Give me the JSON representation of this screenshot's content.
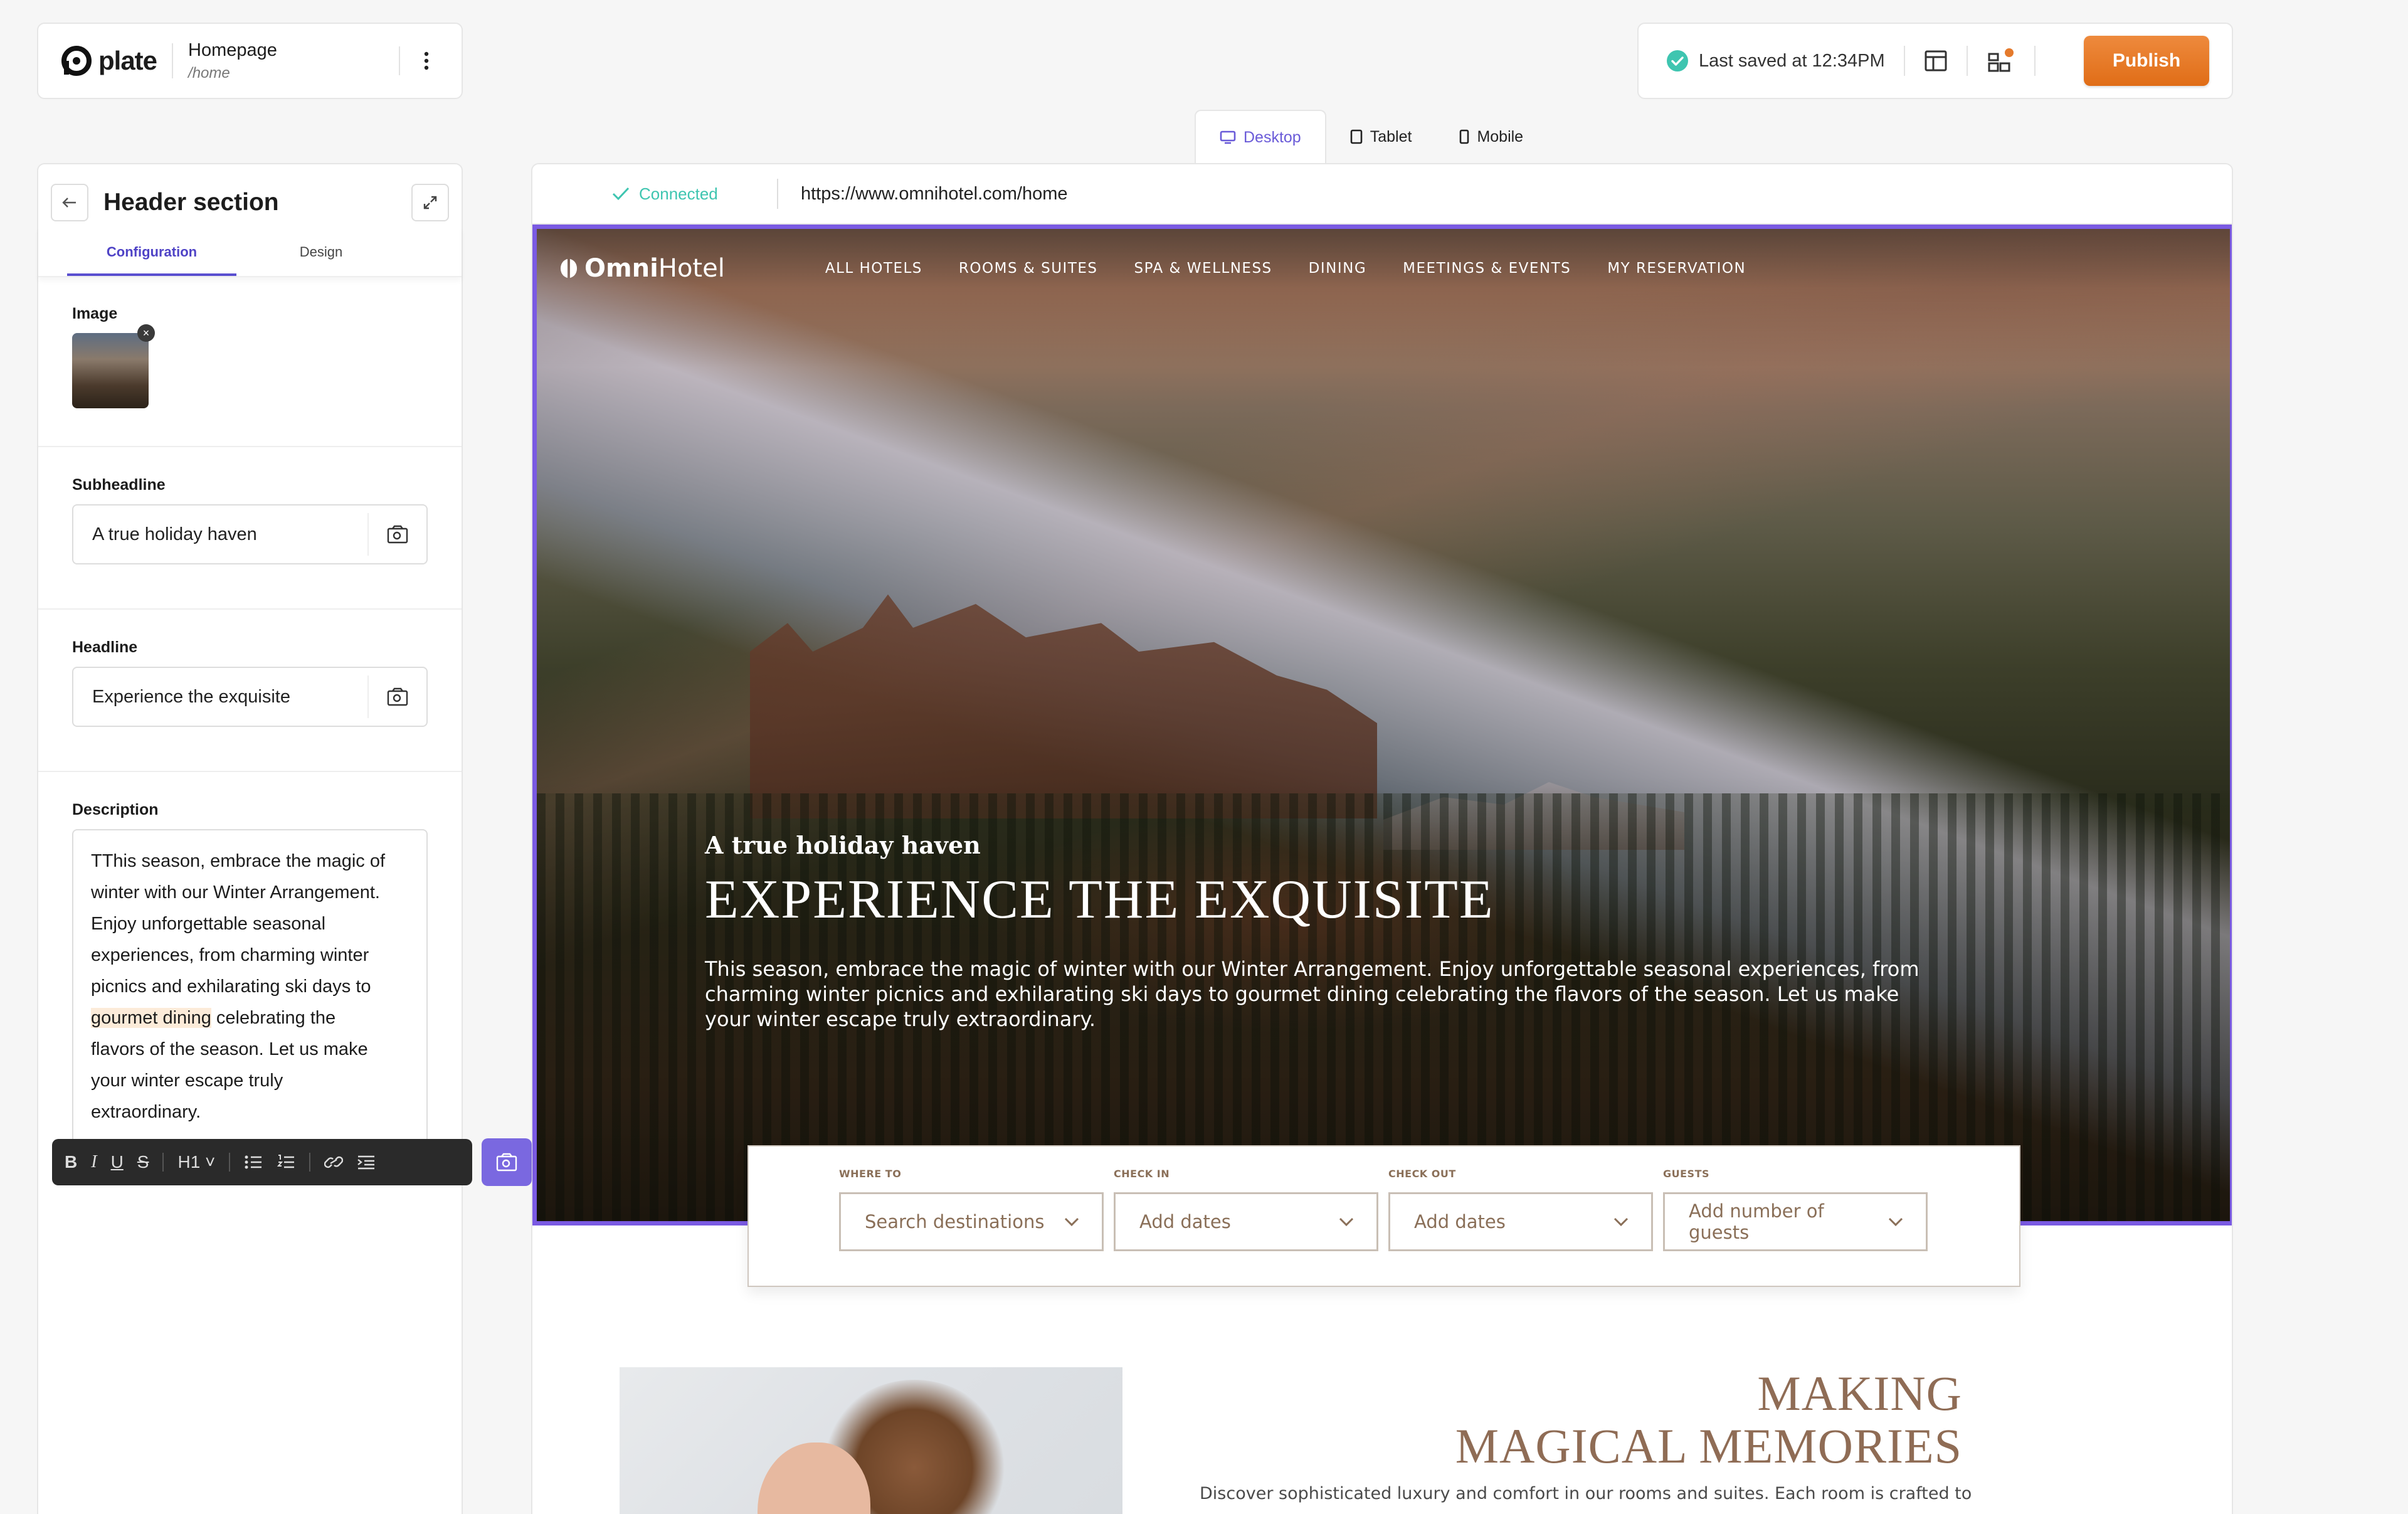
{
  "app": {
    "logo_text": "plate",
    "page_name": "Homepage",
    "page_path": "/home"
  },
  "status": {
    "saved_text": "Last saved at 12:34PM",
    "publish_label": "Publish",
    "accent": "#e57a2c"
  },
  "device_tabs": [
    {
      "label": "Desktop",
      "active": true
    },
    {
      "label": "Tablet",
      "active": false
    },
    {
      "label": "Mobile",
      "active": false
    }
  ],
  "panel": {
    "title": "Header section",
    "tabs": [
      "Configuration",
      "Design"
    ],
    "image_label": "Image",
    "subheadline_label": "Subheadline",
    "subheadline_value": "A true holiday haven",
    "headline_label": "Headline",
    "headline_value": "Experience the exquisite",
    "description_label": "Description",
    "description": {
      "line1": "TThis season, embrace the magic of",
      "line2": "winter with our Winter Arrangement.",
      "line3": "Enjoy unforgettable seasonal",
      "line4": "experiences, from charming winter",
      "line5": "picnics and exhilarating ski days to",
      "highlight": "gourmet dining",
      "line6_rest": " celebrating the",
      "line7": "flavors of the season. Let us make",
      "line8": "your winter escape truly",
      "line9": "extraordinary."
    }
  },
  "toolbar": {
    "heading_label": "H1"
  },
  "browser": {
    "connection": "Connected",
    "url": "https://www.omnihotel.com/home"
  },
  "site": {
    "brand_bold": "Omni",
    "brand_rest": "Hotel",
    "nav": [
      "ALL HOTELS",
      "ROOMS & SUITES",
      "SPA & WELLNESS",
      "DINING",
      "MEETINGS & EVENTS",
      "MY RESERVATION"
    ],
    "hero_sub": "A true holiday haven",
    "hero_head": "EXPERIENCE THE EXQUISITE",
    "hero_desc": "This season, embrace the magic of winter with our Winter Arrangement. Enjoy unforgettable seasonal experiences, from charming winter picnics and exhilarating ski days to gourmet dining celebrating the flavors of the season. Let us make your winter escape truly extraordinary.",
    "booking": [
      {
        "label": "WHERE TO",
        "placeholder": "Search destinations"
      },
      {
        "label": "CHECK IN",
        "placeholder": "Add dates"
      },
      {
        "label": "CHECK OUT",
        "placeholder": "Add dates"
      },
      {
        "label": "GUESTS",
        "placeholder": "Add number of guests"
      }
    ],
    "section_title_1": "MAKING",
    "section_title_2": "MAGICAL MEMORIES",
    "section_desc": "Discover sophisticated luxury and comfort in our rooms and suites. Each room is crafted to"
  }
}
